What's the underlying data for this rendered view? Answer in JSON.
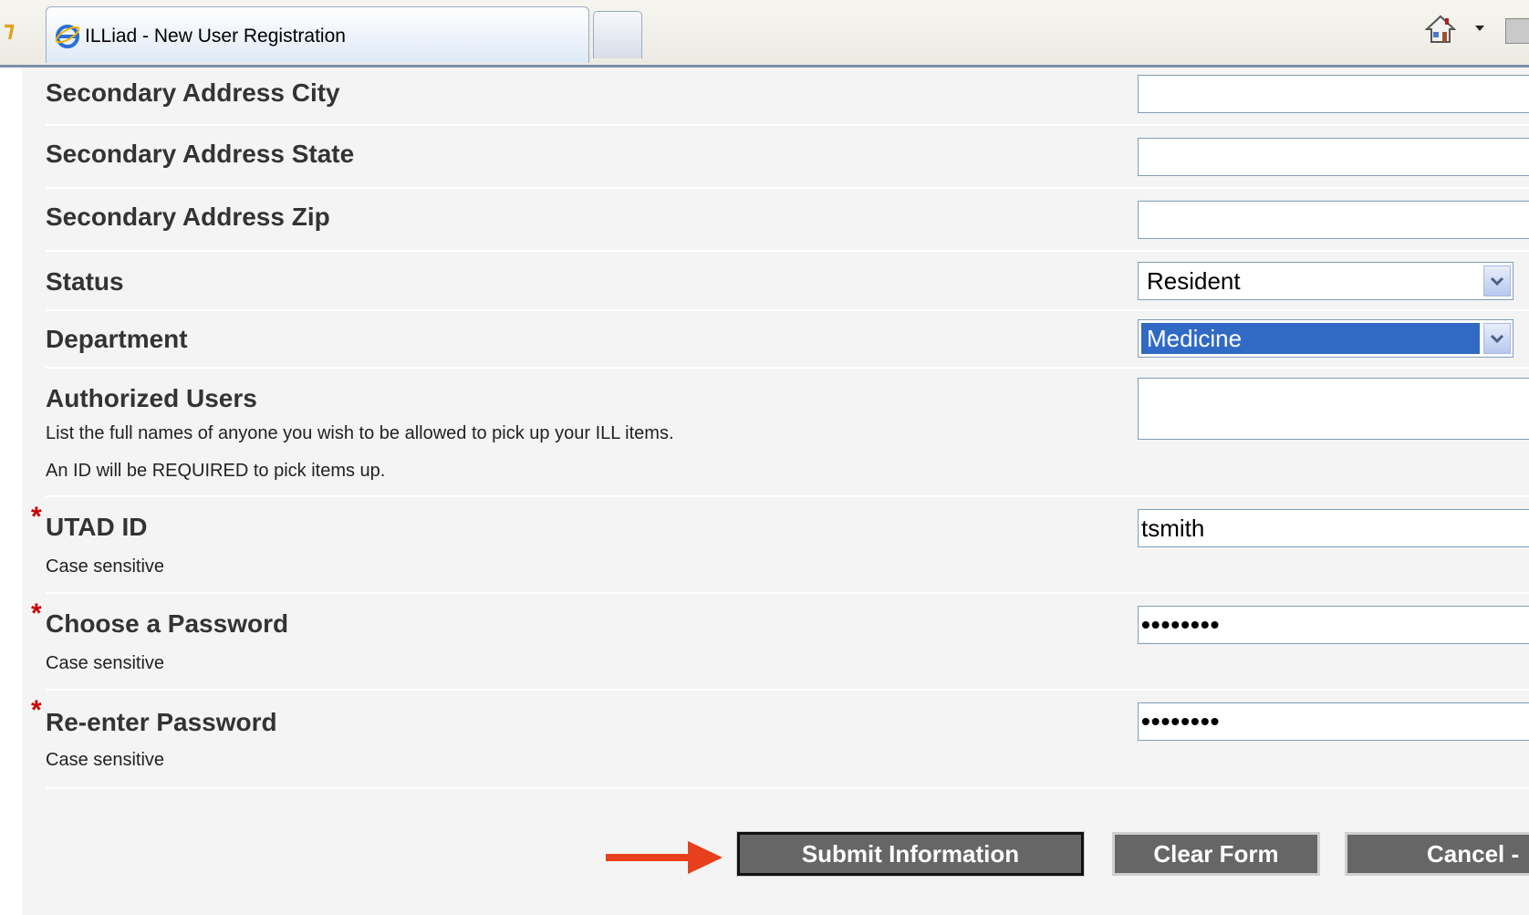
{
  "browser": {
    "tab_title": "ILLiad - New User Registration"
  },
  "form": {
    "secondary_city": {
      "label": "Secondary Address City",
      "value": ""
    },
    "secondary_state": {
      "label": "Secondary Address State",
      "value": ""
    },
    "secondary_zip": {
      "label": "Secondary Address Zip",
      "value": ""
    },
    "status": {
      "label": "Status",
      "selected": "Resident"
    },
    "department": {
      "label": "Department",
      "selected": "Medicine"
    },
    "authorized_users": {
      "label": "Authorized Users",
      "help1": "List the full names of anyone you wish to be allowed to pick up your ILL items.",
      "help2": "An ID will be REQUIRED to pick items up.",
      "value": ""
    },
    "utad_id": {
      "required_mark": "*",
      "label": "UTAD ID",
      "help": "Case sensitive",
      "value": "tsmith"
    },
    "password": {
      "required_mark": "*",
      "label": "Choose a Password",
      "help": "Case sensitive",
      "value": "••••••••"
    },
    "password_confirm": {
      "required_mark": "*",
      "label": "Re-enter Password",
      "help": "Case sensitive",
      "value": "••••••••"
    }
  },
  "buttons": {
    "submit": "Submit Information",
    "clear": "Clear Form",
    "cancel": "Cancel -"
  },
  "colors": {
    "required": "#cc0000",
    "button_bg": "#666666",
    "select_highlight": "#316ac5",
    "annotation_arrow": "#e8401c"
  },
  "icons": [
    "internet-explorer-icon",
    "home-icon",
    "feed-icon",
    "favorites-star-icon"
  ]
}
